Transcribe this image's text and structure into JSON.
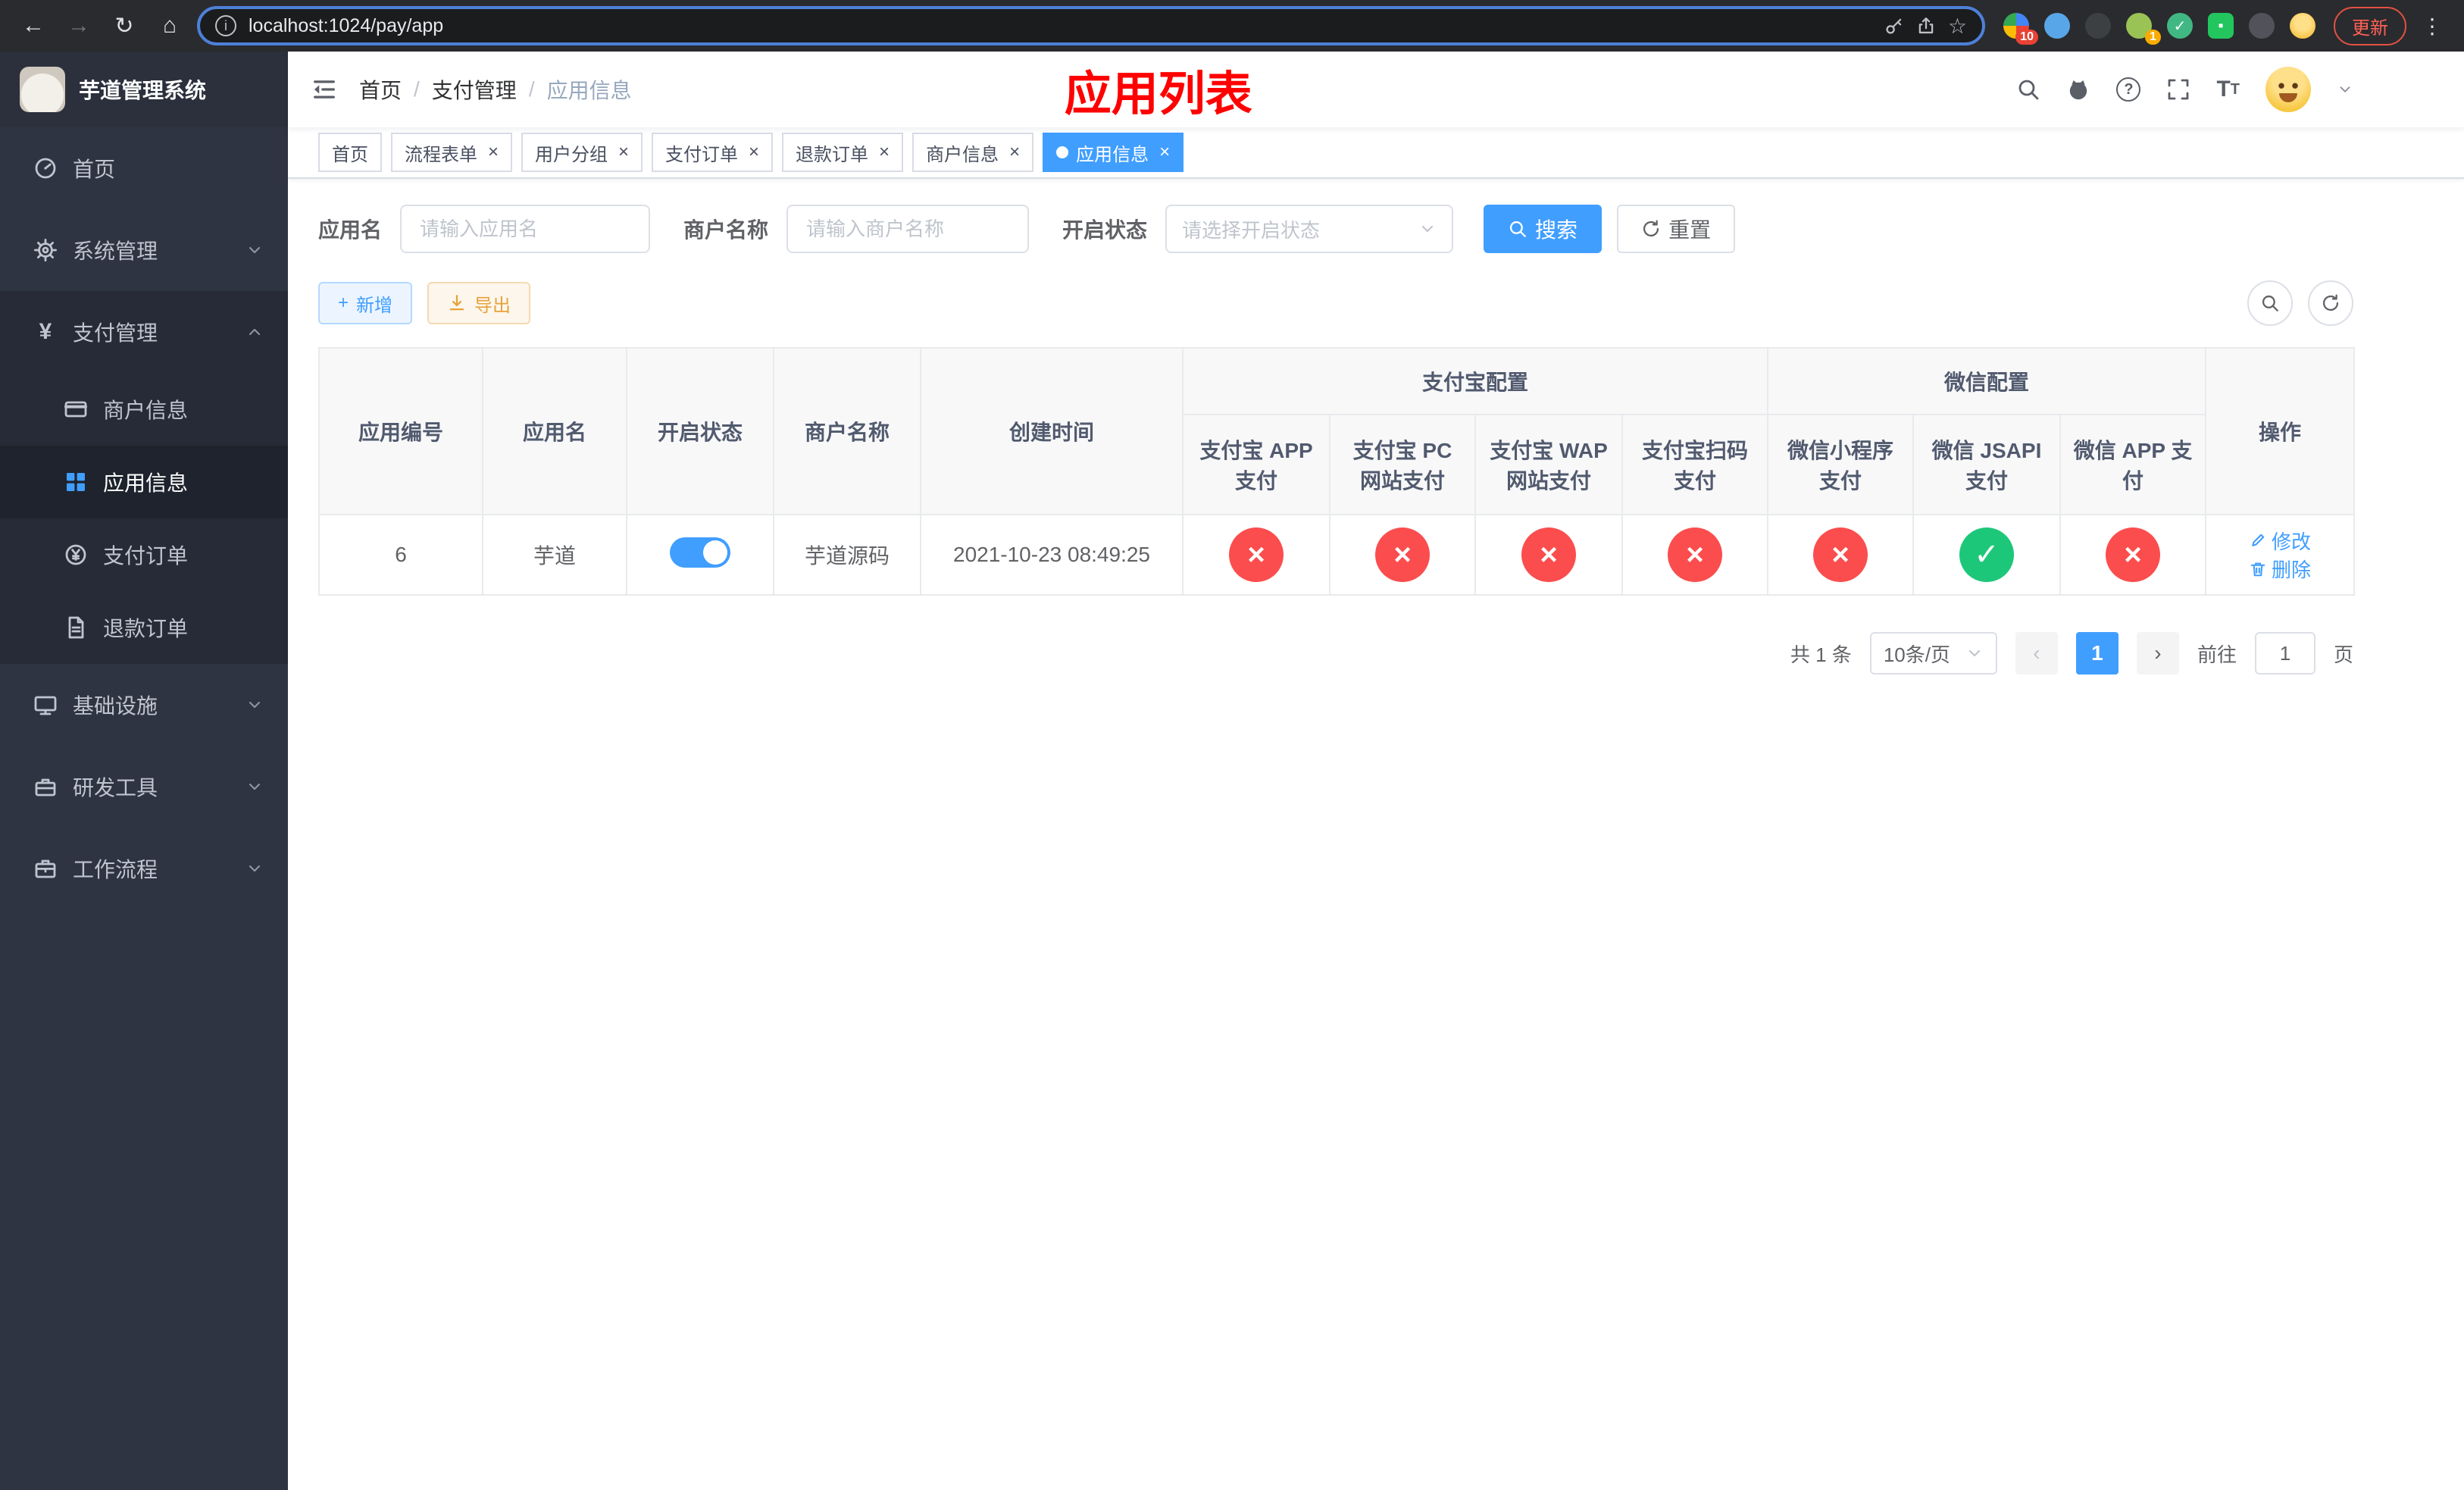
{
  "browser": {
    "url": "localhost:1024/pay/app",
    "update_button": "更新",
    "ext_badge_1": "10",
    "ext_badge_2": "1"
  },
  "sidebar": {
    "app_title": "芋道管理系统",
    "menu": [
      "首页",
      "系统管理",
      "支付管理",
      "商户信息",
      "应用信息",
      "支付订单",
      "退款订单",
      "基础设施",
      "研发工具",
      "工作流程"
    ]
  },
  "header": {
    "breadcrumb": [
      "首页",
      "支付管理",
      "应用信息"
    ],
    "annotation": "应用列表"
  },
  "tabs": [
    {
      "label": "首页"
    },
    {
      "label": "流程表单"
    },
    {
      "label": "用户分组"
    },
    {
      "label": "支付订单"
    },
    {
      "label": "退款订单"
    },
    {
      "label": "商户信息"
    },
    {
      "label": "应用信息"
    }
  ],
  "filters": {
    "app_name_label": "应用名",
    "app_name_placeholder": "请输入应用名",
    "merchant_label": "商户名称",
    "merchant_placeholder": "请输入商户名称",
    "status_label": "开启状态",
    "status_placeholder": "请选择开启状态",
    "search_label": "搜索",
    "reset_label": "重置"
  },
  "toolbar": {
    "add": "新增",
    "export": "导出"
  },
  "table": {
    "columns": {
      "app_id": "应用编号",
      "app_name": "应用名",
      "status": "开启状态",
      "merchant_name": "商户名称",
      "create_time": "创建时间",
      "alipay_group": "支付宝配置",
      "wechat_group": "微信配置",
      "alipay_app": "支付宝 APP 支付",
      "alipay_pc": "支付宝 PC 网站支付",
      "alipay_wap": "支付宝 WAP 网站支付",
      "alipay_qr": "支付宝扫码支付",
      "wx_mini": "微信小程序支付",
      "wx_jsapi": "微信 JSAPI 支付",
      "wx_app": "微信 APP 支付",
      "actions": "操作"
    },
    "rows": [
      {
        "app_id": "6",
        "app_name": "芋道",
        "status_on": true,
        "merchant_name": "芋道源码",
        "create_time": "2021-10-23 08:49:25",
        "configs": {
          "alipay_app": false,
          "alipay_pc": false,
          "alipay_wap": false,
          "alipay_qr": false,
          "wx_mini": false,
          "wx_jsapi": true,
          "wx_app": false
        },
        "edit": "修改",
        "delete": "删除"
      }
    ]
  },
  "pagination": {
    "total": "共 1 条",
    "page_size": "10条/页",
    "page": "1",
    "goto": "前往",
    "goto_value": "1",
    "unit": "页"
  }
}
